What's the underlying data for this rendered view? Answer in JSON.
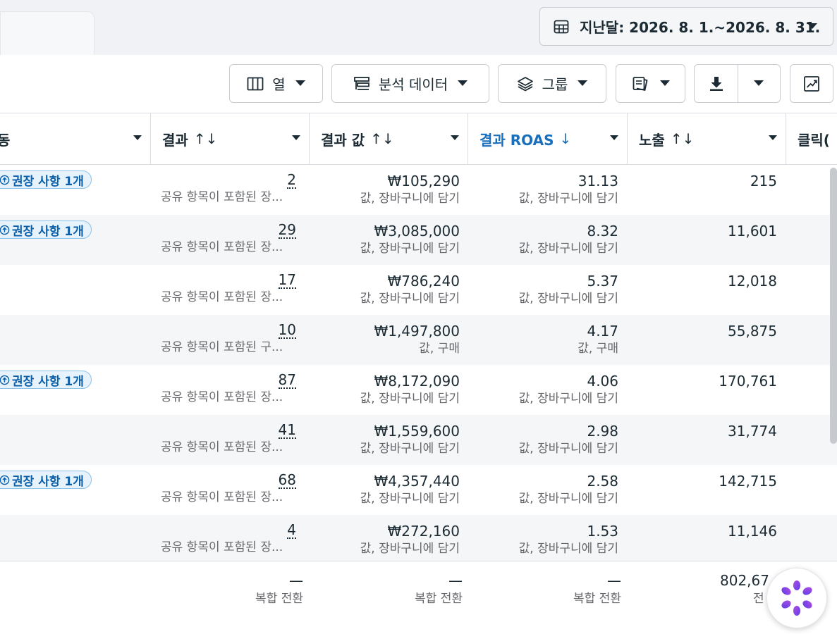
{
  "date_range": {
    "label": "지난달: 2026. 8. 1.~2026. 8. 31."
  },
  "toolbar": {
    "columns_label": "열",
    "breakdown_label": "분석 데이터",
    "group_label": "그룹"
  },
  "table": {
    "columns": [
      {
        "label": "동"
      },
      {
        "label": "결과",
        "sort": "↑↓"
      },
      {
        "label": "결과 값",
        "sort": "↑↓"
      },
      {
        "label": "결과 ROAS",
        "sort": "↓"
      },
      {
        "label": "노출",
        "sort": "↑↓"
      },
      {
        "label": "클릭("
      }
    ],
    "badge_text": "권장 사항 1개",
    "rows": [
      {
        "badge": true,
        "results": "2",
        "results_sub": "공유 항목이 포함된 장...",
        "value": "₩105,290",
        "value_sub": "값, 장바구니에 담기",
        "roas": "31.13",
        "roas_sub": "값, 장바구니에 담기",
        "impressions": "215"
      },
      {
        "badge": true,
        "results": "29",
        "results_sub": "공유 항목이 포함된 장...",
        "value": "₩3,085,000",
        "value_sub": "값, 장바구니에 담기",
        "roas": "8.32",
        "roas_sub": "값, 장바구니에 담기",
        "impressions": "11,601"
      },
      {
        "badge": false,
        "results": "17",
        "results_sub": "공유 항목이 포함된 장...",
        "value": "₩786,240",
        "value_sub": "값, 장바구니에 담기",
        "roas": "5.37",
        "roas_sub": "값, 장바구니에 담기",
        "impressions": "12,018"
      },
      {
        "badge": false,
        "results": "10",
        "results_sub": "공유 항목이 포함된 구...",
        "value": "₩1,497,800",
        "value_sub": "값, 구매",
        "roas": "4.17",
        "roas_sub": "값, 구매",
        "impressions": "55,875"
      },
      {
        "badge": true,
        "results": "87",
        "results_sub": "공유 항목이 포함된 장...",
        "value": "₩8,172,090",
        "value_sub": "값, 장바구니에 담기",
        "roas": "4.06",
        "roas_sub": "값, 장바구니에 담기",
        "impressions": "170,761"
      },
      {
        "badge": false,
        "results": "41",
        "results_sub": "공유 항목이 포함된 장...",
        "value": "₩1,559,600",
        "value_sub": "값, 장바구니에 담기",
        "roas": "2.98",
        "roas_sub": "값, 장바구니에 담기",
        "impressions": "31,774"
      },
      {
        "badge": true,
        "results": "68",
        "results_sub": "공유 항목이 포함된 장...",
        "value": "₩4,357,440",
        "value_sub": "값, 장바구니에 담기",
        "roas": "2.58",
        "roas_sub": "값, 장바구니에 담기",
        "impressions": "142,715"
      },
      {
        "badge": false,
        "results": "4",
        "results_sub": "공유 항목이 포함된 장...",
        "value": "₩272,160",
        "value_sub": "값, 장바구니에 담기",
        "roas": "1.53",
        "roas_sub": "값, 장바구니에 담기",
        "impressions": "11,146"
      }
    ]
  },
  "footer": {
    "results": "—",
    "results_sub": "복합 전환",
    "value": "—",
    "value_sub": "복합 전환",
    "roas": "—",
    "roas_sub": "복합 전환",
    "impressions": "802,67",
    "impressions_sub": "전"
  },
  "colors": {
    "accent": "#1a6fbd",
    "badge_text": "#0a5ea8",
    "badge_bg": "#e7f3fc"
  },
  "icons": [
    "calendar-grid-icon",
    "caret-down-icon",
    "columns-icon",
    "breakdown-icon",
    "layers-icon",
    "reports-icon",
    "download-icon",
    "trend-chart-icon",
    "recommendation-icon",
    "assistant-icon"
  ]
}
